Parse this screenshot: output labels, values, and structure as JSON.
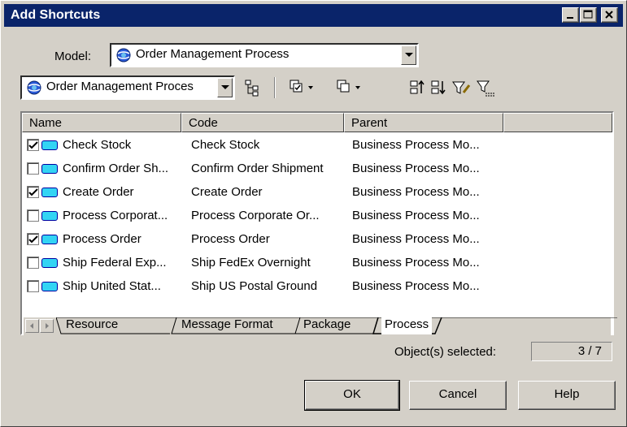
{
  "window": {
    "title": "Add Shortcuts",
    "controls": {
      "minimize": "minimize-icon",
      "maximize": "maximize-icon",
      "close": "close-icon"
    }
  },
  "model": {
    "label": "Model:",
    "selected": "Order Management Process",
    "icon": "globe-model-icon"
  },
  "toolbar": {
    "filter_combo": "Order Management Proces",
    "icons": [
      "hierarchy-icon",
      "select-all-icon",
      "deselect-all-icon",
      "move-up-icon",
      "move-down-icon",
      "filter-icon",
      "filter-list-icon"
    ]
  },
  "list": {
    "columns": [
      "Name",
      "Code",
      "Parent"
    ],
    "rows": [
      {
        "checked": true,
        "name": "Check Stock",
        "code": "Check Stock",
        "parent": "Business Process Mo..."
      },
      {
        "checked": false,
        "name": "Confirm Order Sh...",
        "code": "Confirm Order Shipment",
        "parent": "Business Process Mo..."
      },
      {
        "checked": true,
        "name": "Create Order",
        "code": "Create Order",
        "parent": "Business Process Mo..."
      },
      {
        "checked": false,
        "name": "Process Corporat...",
        "code": "Process Corporate Or...",
        "parent": "Business Process Mo..."
      },
      {
        "checked": true,
        "name": "Process Order",
        "code": "Process Order",
        "parent": "Business Process Mo..."
      },
      {
        "checked": false,
        "name": "Ship Federal Exp...",
        "code": "Ship FedEx Overnight",
        "parent": "Business Process Mo..."
      },
      {
        "checked": false,
        "name": "Ship United Stat...",
        "code": "Ship US Postal Ground",
        "parent": "Business Process Mo..."
      }
    ],
    "tabs": [
      "Resource",
      "Message Format",
      "Package",
      "Process"
    ],
    "active_tab": "Process"
  },
  "status": {
    "label": "Object(s) selected:",
    "count": "3 / 7"
  },
  "buttons": {
    "ok": "OK",
    "cancel": "Cancel",
    "help": "Help"
  },
  "colors": {
    "titlebar": "#0a246a",
    "face": "#d4d0c8",
    "process_icon": "#33d4f4"
  }
}
